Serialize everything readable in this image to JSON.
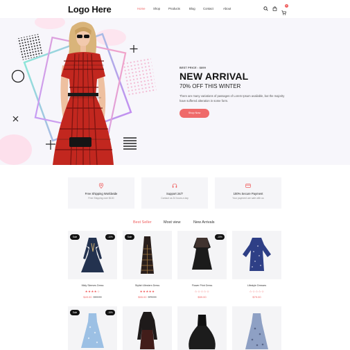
{
  "header": {
    "logo": "Logo Here",
    "nav": [
      "Home",
      "Shop",
      "Products",
      "Blog",
      "Contact",
      "About"
    ],
    "active_nav": "Home",
    "cart_count": "0"
  },
  "hero": {
    "best_price": "BEST PRICE : $899",
    "title": "NEW ARRIVAL",
    "subtitle": "70% OFF THIS WINTER",
    "description": "There are many variations of passages of Lorem Ipsum available, but the majority have suffered alteration in some form.",
    "button": "Shop Now"
  },
  "features": [
    {
      "title": "Free Shipping Worldwide",
      "desc": "Free Shipping over $100",
      "icon": "location-pin-icon"
    },
    {
      "title": "Support 24/7",
      "desc": "Contact us 24 hours a day",
      "icon": "headphones-icon"
    },
    {
      "title": "100% Secure Payment",
      "desc": "Your payment are safe with us",
      "icon": "credit-card-icon"
    }
  ],
  "tabs": [
    "Best Seller",
    "Most view",
    "New Arrivals"
  ],
  "active_tab": "Best Seller",
  "products": [
    {
      "name": "Midy Sleeves Dress",
      "stars": "★★★★☆",
      "price": "$49.00",
      "old_price": "$59.00",
      "label_sale": "Sale",
      "label_disc": "-10%"
    },
    {
      "name": "Stylish Western Dress",
      "stars": "★★★★★",
      "price": "$55.00",
      "old_price": "$75.00",
      "label_sale": "Sale",
      "label_disc": ""
    },
    {
      "name": "Flower Print Dress",
      "stars": "☆☆☆☆☆",
      "price": "$59.00",
      "old_price": "",
      "label_sale": "",
      "label_disc": "-15%"
    },
    {
      "name": "Lifestyle Dresses",
      "stars": "☆☆☆☆☆",
      "price": "$79.00",
      "old_price": "",
      "label_sale": "",
      "label_disc": ""
    },
    {
      "name": "",
      "stars": "",
      "price": "",
      "old_price": "",
      "label_sale": "Sale",
      "label_disc": "-15%"
    },
    {
      "name": "",
      "stars": "",
      "price": "",
      "old_price": "",
      "label_sale": "",
      "label_disc": ""
    },
    {
      "name": "",
      "stars": "",
      "price": "",
      "old_price": "",
      "label_sale": "",
      "label_disc": ""
    },
    {
      "name": "",
      "stars": "",
      "price": "",
      "old_price": "",
      "label_sale": "",
      "label_disc": ""
    }
  ],
  "colors": {
    "accent": "#ef5d5d",
    "hero_bg": "#f7f6fb",
    "card_bg": "#f4f4f6"
  }
}
